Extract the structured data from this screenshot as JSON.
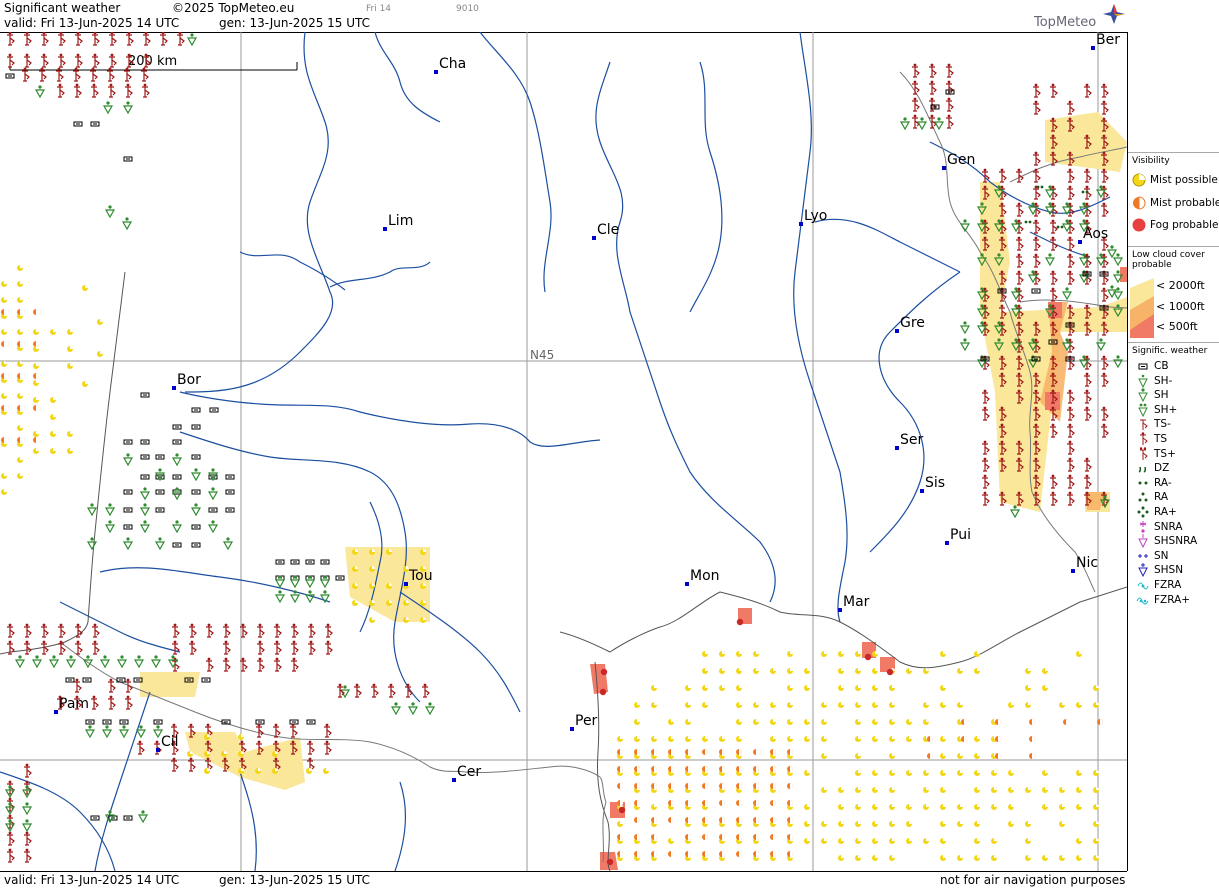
{
  "header": {
    "title": "Significant weather",
    "copyright": "©2025 TopMeteo.eu",
    "valid": "valid:  Fri  13-Jun-2025  14 UTC",
    "gen": "gen: 13-Jun-2025  15 UTC",
    "faint_day": "Fri 14",
    "faint_code": "9010",
    "logo": "TopMeteo"
  },
  "footer": {
    "valid": "valid:  Fri  13-Jun-2025  14 UTC",
    "gen": "gen: 13-Jun-2025  15 UTC",
    "disclaimer": "not for air navigation purposes"
  },
  "map": {
    "scale_label": "200 km",
    "latitude_label": "N45",
    "cities": [
      "Cha",
      "Lim",
      "Cle",
      "Lyo",
      "Ber",
      "Gen",
      "Aos",
      "Gre",
      "Bor",
      "Ser",
      "Sis",
      "Pui",
      "Tou",
      "Mon",
      "Mar",
      "Nic",
      "Pam",
      "Cil",
      "Per",
      "Cer"
    ],
    "colors": {
      "ts": "#a01818",
      "shower": "#2e8b2e",
      "mist_possible": "#f3d616",
      "mist_probable": "#f07a24",
      "fog_probable": "#e64040",
      "cloud_2000": "#fbe79a",
      "cloud_1000": "#f7b468",
      "cloud_500": "#f07a66",
      "rivers": "#1c4fa0",
      "border": "#666666"
    }
  },
  "legend": {
    "visibility_title": "Visibility",
    "visibility": [
      "Mist possible",
      "Mist probable",
      "Fog probable"
    ],
    "low_cloud_title": "Low cloud cover probable",
    "low_cloud": [
      "< 2000ft",
      "< 1000ft",
      "<   500ft"
    ],
    "sigwx_title": "Signific. weather",
    "sigwx": [
      "CB",
      "SH-",
      "SH",
      "SH+",
      "TS-",
      "TS",
      "TS+",
      "DZ",
      "RA-",
      "RA",
      "RA+",
      "SNRA",
      "SHSNRA",
      "SN",
      "SHSN",
      "FZRA",
      "FZRA+"
    ]
  }
}
